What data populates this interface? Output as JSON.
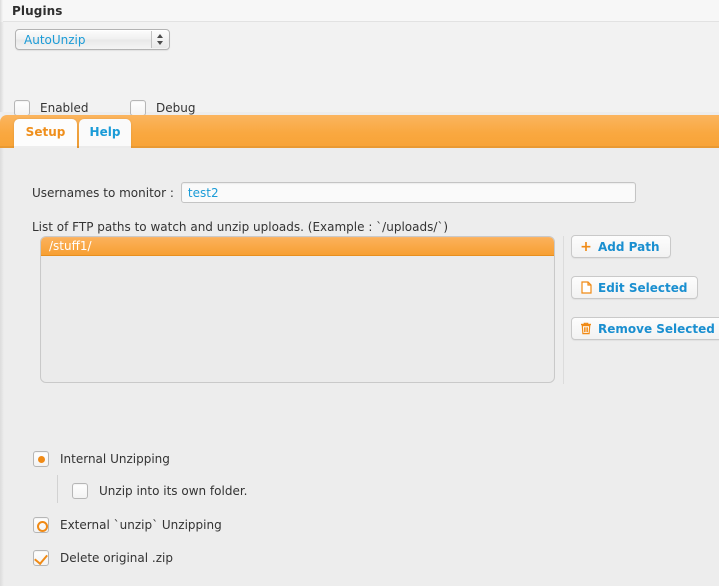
{
  "header": {
    "title": "Plugins"
  },
  "plugin_select": {
    "selected": "AutoUnzip",
    "options": [
      "AutoUnzip"
    ],
    "icon": "chevron-updown-icon"
  },
  "toggles": [
    {
      "label": "Enabled",
      "checked": false
    },
    {
      "label": "Debug",
      "checked": false
    }
  ],
  "tabs": [
    {
      "label": "Setup",
      "active": true
    },
    {
      "label": "Help",
      "active": false
    }
  ],
  "setup": {
    "usernames": {
      "label": "Usernames to monitor :",
      "value": "test2",
      "placeholder": ""
    },
    "paths": {
      "caption": "List of FTP paths to watch and unzip uploads. (Example : `/uploads/`)",
      "items": [
        {
          "path": "/stuff1/",
          "selected": true
        }
      ]
    },
    "buttons": [
      {
        "label": "Add Path",
        "icon": "plus-icon"
      },
      {
        "label": "Edit Selected",
        "icon": "document-icon"
      },
      {
        "label": "Remove Selected",
        "icon": "trash-icon"
      }
    ],
    "options": [
      {
        "label": "Internal Unzipping",
        "type": "radio",
        "selected": true
      },
      {
        "label": "Unzip into its own folder.",
        "type": "checkbox",
        "checked": false
      },
      {
        "label": "External `unzip` Unzipping",
        "type": "radio",
        "selected": false
      },
      {
        "label": "Delete original .zip",
        "type": "checkbox",
        "checked": true
      }
    ]
  },
  "colors": {
    "accent_orange": "#f9a840",
    "link_blue": "#1a9bd7",
    "icon_orange": "#f08a15",
    "background": "#ededed",
    "selected_row": "#f7a033"
  }
}
